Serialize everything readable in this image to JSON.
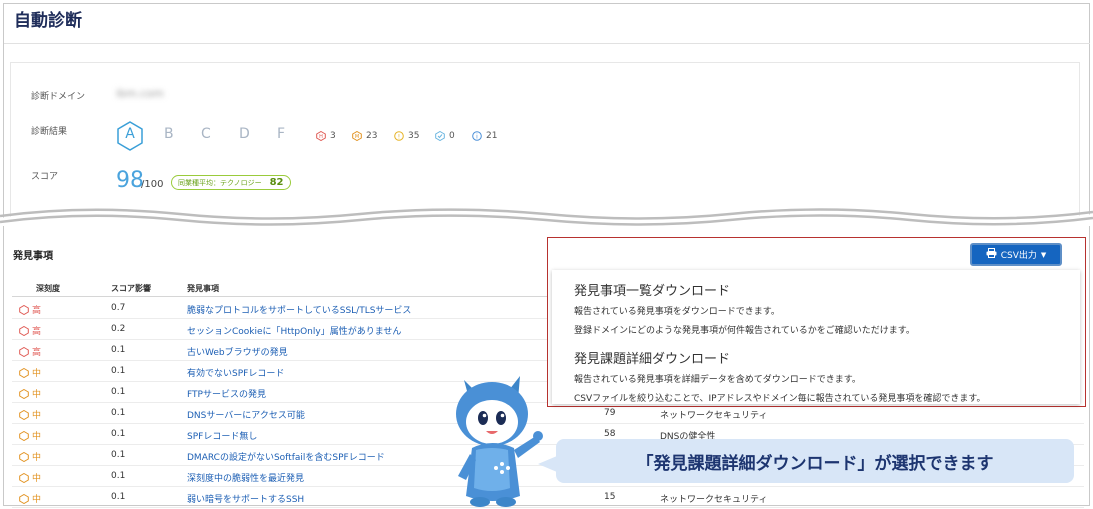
{
  "page": {
    "title": "自動診断"
  },
  "summary": {
    "domain_label": "診断ドメイン",
    "domain_value": "ibm.com",
    "result_label": "診断結果",
    "grades": [
      "A",
      "B",
      "C",
      "D",
      "F"
    ],
    "current_grade": "A",
    "counts": [
      {
        "icon": "severity-high-icon",
        "value": "3"
      },
      {
        "icon": "severity-mid-icon",
        "value": "23"
      },
      {
        "icon": "severity-low-icon",
        "value": "35"
      },
      {
        "icon": "check-shield-icon",
        "value": "0"
      },
      {
        "icon": "info-icon",
        "value": "21"
      }
    ],
    "score_label": "スコア",
    "score": "98",
    "score_max": "/100",
    "industry_avg_label": "同業種平均：テクノロジー",
    "industry_avg_value": "82"
  },
  "findings": {
    "title": "発見事項",
    "columns": {
      "severity": "深刻度",
      "impact": "スコア影響",
      "finding": "発見事項"
    },
    "rows": [
      {
        "severity": "高",
        "level": "high",
        "impact": "0.7",
        "name": "脆弱なプロトコルをサポートしているSSL/TLSサービス",
        "count": "",
        "category": ""
      },
      {
        "severity": "高",
        "level": "high",
        "impact": "0.2",
        "name": "セッションCookieに「HttpOnly」属性がありません",
        "count": "",
        "category": ""
      },
      {
        "severity": "高",
        "level": "high",
        "impact": "0.1",
        "name": "古いWebブラウザの発見",
        "count": "",
        "category": ""
      },
      {
        "severity": "中",
        "level": "mid",
        "impact": "0.1",
        "name": "有効でないSPFレコード",
        "count": "",
        "category": ""
      },
      {
        "severity": "中",
        "level": "mid",
        "impact": "0.1",
        "name": "FTPサービスの発見",
        "count": "",
        "category": ""
      },
      {
        "severity": "中",
        "level": "mid",
        "impact": "0.1",
        "name": "DNSサーバーにアクセス可能",
        "count": "79",
        "category": "ネットワークセキュリティ"
      },
      {
        "severity": "中",
        "level": "mid",
        "impact": "0.1",
        "name": "SPFレコード無し",
        "count": "58",
        "category": "DNSの健全性"
      },
      {
        "severity": "中",
        "level": "mid",
        "impact": "0.1",
        "name": "DMARCの設定がないSoftfailを含むSPFレコード",
        "count": "",
        "category": ""
      },
      {
        "severity": "中",
        "level": "mid",
        "impact": "0.1",
        "name": "深刻度中の脆弱性を最近発見",
        "count": "",
        "category": ""
      },
      {
        "severity": "中",
        "level": "mid",
        "impact": "0.1",
        "name": "弱い暗号をサポートするSSH",
        "count": "15",
        "category": "ネットワークセキュリティ"
      }
    ]
  },
  "csv_menu": {
    "button_label": "CSV出力",
    "items": [
      {
        "title": "発見事項一覧ダウンロード",
        "desc1": "報告されている発見事項をダウンロードできます。",
        "desc2": "登録ドメインにどのような発見事項が何件報告されているかをご確認いただけます。"
      },
      {
        "title": "発見課題詳細ダウンロード",
        "desc1": "報告されている発見事項を詳細データを含めてダウンロードできます。",
        "desc2": "CSVファイルを絞り込むことで、IPアドレスやドメイン毎に報告されている発見事項を確認できます。"
      }
    ]
  },
  "callout": {
    "text": "「発見課題詳細ダウンロード」が選択できます"
  },
  "colors": {
    "high": "#e05a54",
    "mid": "#e29322",
    "accent": "#1565c0",
    "frame_highlight": "#b7322f"
  }
}
